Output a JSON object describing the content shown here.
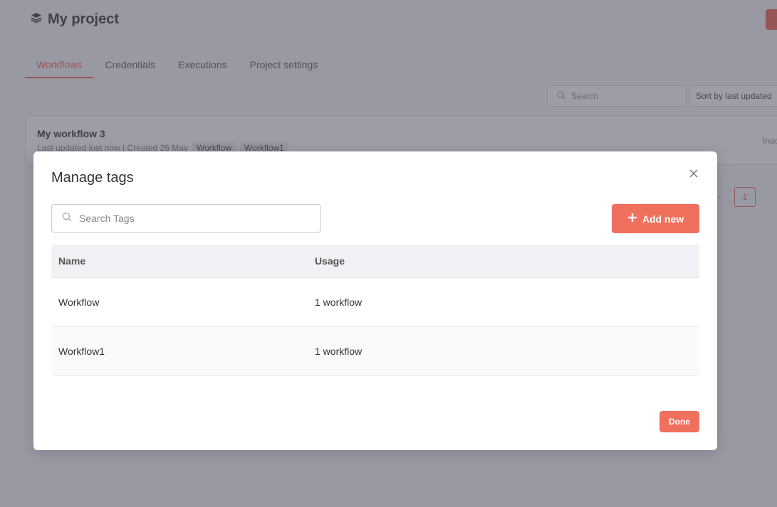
{
  "project": {
    "title": "My project"
  },
  "tabs": [
    {
      "label": "Workflows",
      "active": true
    },
    {
      "label": "Credentials",
      "active": false
    },
    {
      "label": "Executions",
      "active": false
    },
    {
      "label": "Project settings",
      "active": false
    }
  ],
  "toolbar": {
    "search_placeholder": "Search",
    "sort_label": "Sort by last updated"
  },
  "workflow_card": {
    "name": "My workflow 3",
    "meta": "Last updated just now | Created 26 May",
    "tags": [
      "Workflow",
      "Workflow1"
    ],
    "status": "Inactive"
  },
  "pager": {
    "current": "1"
  },
  "modal": {
    "title": "Manage tags",
    "search_placeholder": "Search Tags",
    "add_label": "Add new",
    "columns": {
      "name": "Name",
      "usage": "Usage"
    },
    "rows": [
      {
        "name": "Workflow",
        "usage": "1 workflow"
      },
      {
        "name": "Workflow1",
        "usage": "1 workflow"
      }
    ],
    "done_label": "Done"
  },
  "colors": {
    "accent": "#f0705e",
    "overlay": "#3c3c50"
  }
}
